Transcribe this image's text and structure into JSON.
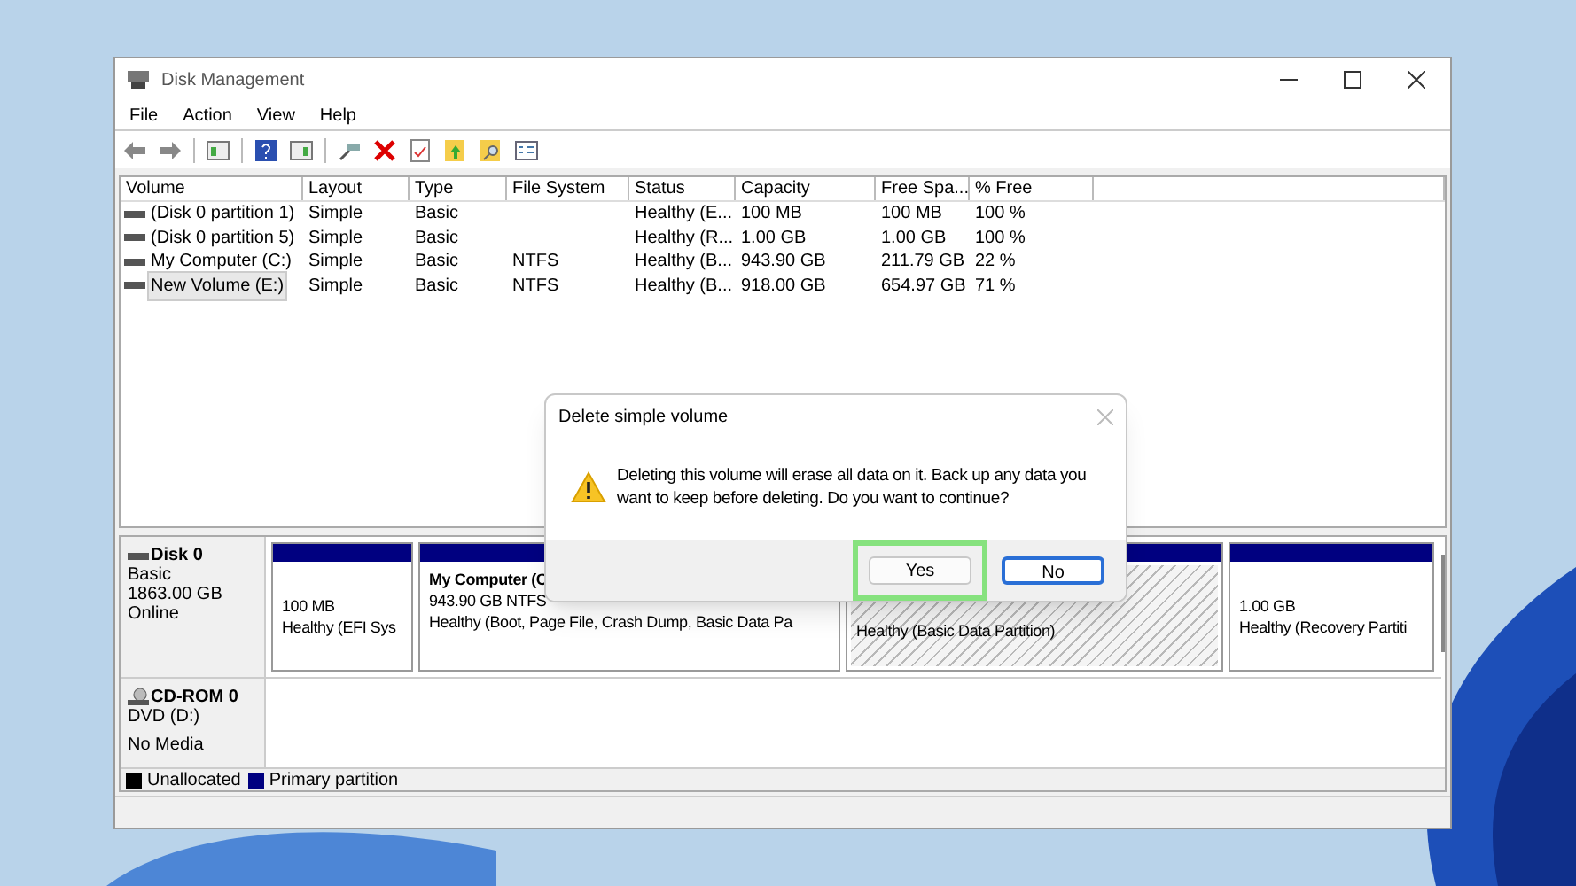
{
  "window": {
    "title": "Disk Management"
  },
  "menu": [
    {
      "label": "File"
    },
    {
      "label": "Action"
    },
    {
      "label": "View"
    },
    {
      "label": "Help"
    }
  ],
  "table": {
    "columns": [
      "Volume",
      "Layout",
      "Type",
      "File System",
      "Status",
      "Capacity",
      "Free Spa...",
      "% Free"
    ],
    "rows": [
      {
        "selected": false,
        "cells": [
          "(Disk 0 partition 1)",
          "Simple",
          "Basic",
          "",
          "Healthy (E...",
          "100 MB",
          "100 MB",
          "100 %"
        ]
      },
      {
        "selected": false,
        "cells": [
          "(Disk 0 partition 5)",
          "Simple",
          "Basic",
          "",
          "Healthy (R...",
          "1.00 GB",
          "1.00 GB",
          "100 %"
        ]
      },
      {
        "selected": false,
        "cells": [
          "My Computer (C:)",
          "Simple",
          "Basic",
          "NTFS",
          "Healthy (B...",
          "943.90 GB",
          "211.79 GB",
          "22 %"
        ]
      },
      {
        "selected": true,
        "cells": [
          "New Volume (E:)",
          "Simple",
          "Basic",
          "NTFS",
          "Healthy (B...",
          "918.00 GB",
          "654.97 GB",
          "71 %"
        ]
      }
    ]
  },
  "disks": [
    {
      "kind": "disk",
      "name": "Disk 0",
      "lines": [
        "Basic",
        "1863.00 GB",
        "Online"
      ],
      "partitions": [
        {
          "selected": false,
          "lines": [
            "100 MB",
            "Healthy (EFI Sys"
          ]
        },
        {
          "selected": false,
          "title": "My Computer  (C",
          "lines": [
            "943.90 GB NTFS",
            "Healthy (Boot, Page File, Crash Dump, Basic Data Pa"
          ]
        },
        {
          "selected": true,
          "lines": [
            "Healthy (Basic Data Partition)"
          ]
        },
        {
          "selected": false,
          "lines": [
            "1.00 GB",
            "Healthy (Recovery Partiti"
          ]
        }
      ]
    },
    {
      "kind": "cdrom",
      "name": "CD-ROM 0",
      "lines": [
        "DVD (D:)",
        "No Media"
      ]
    }
  ],
  "legend": [
    {
      "label": "Unallocated",
      "color": "#000000"
    },
    {
      "label": "Primary partition",
      "color": "#000080"
    }
  ],
  "dialog": {
    "title": "Delete simple volume",
    "message": "Deleting this volume will erase all data on it. Back up any data you want to keep before deleting. Do you want to continue?",
    "buttons": [
      {
        "label": "Yes",
        "highlighted": true,
        "focused": false
      },
      {
        "label": "No",
        "highlighted": false,
        "focused": true
      }
    ]
  }
}
